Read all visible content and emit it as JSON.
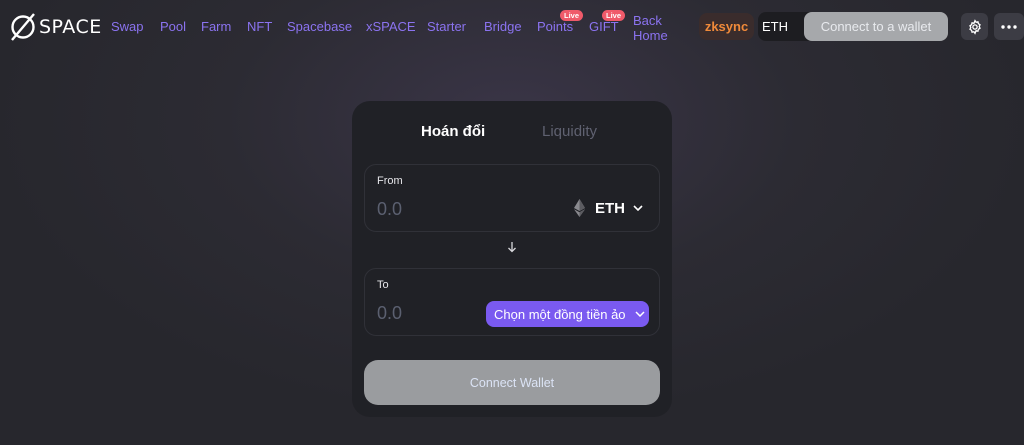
{
  "header": {
    "logo_text": "SPACE",
    "nav": [
      {
        "label": "Swap"
      },
      {
        "label": "Pool"
      },
      {
        "label": "Farm"
      },
      {
        "label": "NFT"
      },
      {
        "label": "Spacebase"
      },
      {
        "label": "xSPACE"
      },
      {
        "label": "Starter"
      },
      {
        "label": "Bridge"
      },
      {
        "label": "Points",
        "badge": "Live"
      },
      {
        "label": "GIFT",
        "badge": "Live"
      },
      {
        "label": "Back Home"
      }
    ],
    "network": "zksync",
    "balance_token": "ETH",
    "connect_label": "Connect to a wallet",
    "settings_icon": "gear-icon",
    "more_icon": "more-icon"
  },
  "swap": {
    "tabs": [
      "Hoán đổi",
      "Liquidity"
    ],
    "from": {
      "label": "From",
      "amount_placeholder": "0.0",
      "token": "ETH",
      "token_icon": "eth-icon"
    },
    "to": {
      "label": "To",
      "amount_placeholder": "0.0",
      "select_label": "Chọn một đồng tiền ảo"
    },
    "connect_label": "Connect Wallet"
  },
  "colors": {
    "accent": "#7a5af0",
    "nav_link": "#8b73f0",
    "network": "#f08a3a",
    "badge": "#f05a6a"
  }
}
